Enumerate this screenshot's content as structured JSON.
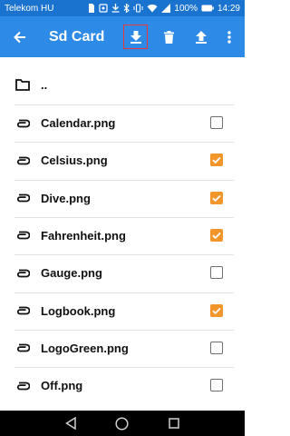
{
  "status_bar": {
    "carrier": "Telekom HU",
    "battery": "100%",
    "time": "14:29",
    "icons": [
      "sim-icon",
      "notification-icon",
      "download-status-icon",
      "bluetooth-icon",
      "vibrate-icon",
      "wifi-icon",
      "signal-icon",
      "battery-icon"
    ]
  },
  "app_bar": {
    "title": "Sd Card",
    "actions": [
      "back-arrow-icon",
      "download-icon",
      "delete-icon",
      "upload-icon",
      "more-vert-icon"
    ],
    "highlight_color": "#e53935"
  },
  "parent_entry": {
    "label": "..",
    "icon": "folder-icon"
  },
  "files": [
    {
      "name": "Calendar.png",
      "checked": false
    },
    {
      "name": "Celsius.png",
      "checked": true
    },
    {
      "name": "Dive.png",
      "checked": true
    },
    {
      "name": "Fahrenheit.png",
      "checked": true
    },
    {
      "name": "Gauge.png",
      "checked": false
    },
    {
      "name": "Logbook.png",
      "checked": true
    },
    {
      "name": "LogoGreen.png",
      "checked": false
    },
    {
      "name": "Off.png",
      "checked": false
    }
  ],
  "colors": {
    "status_bar": "#1a73cf",
    "app_bar": "#2d8ae6",
    "checkbox_checked": "#f2962c"
  },
  "nav_bar": {
    "buttons": [
      "back-triangle-icon",
      "home-circle-icon",
      "recents-square-icon"
    ]
  }
}
